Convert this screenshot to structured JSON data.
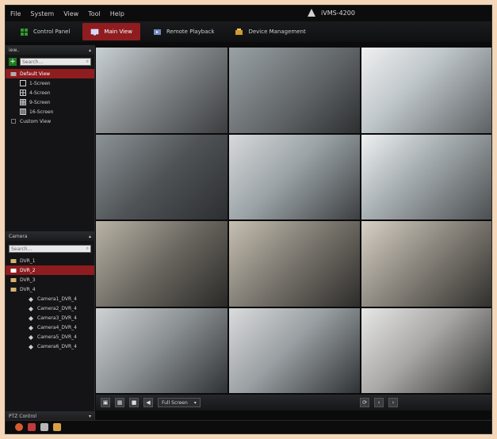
{
  "menubar": {
    "items": [
      "File",
      "System",
      "View",
      "Tool",
      "Help"
    ]
  },
  "app": {
    "title": "iVMS-4200"
  },
  "tabs": [
    {
      "label": "Control Panel",
      "icon": "grid-icon"
    },
    {
      "label": "Main View",
      "icon": "monitor-icon",
      "active": true
    },
    {
      "label": "Remote Playback",
      "icon": "playback-icon"
    },
    {
      "label": "Device Management",
      "icon": "device-icon"
    }
  ],
  "left": {
    "view_panel": {
      "title": "iew..",
      "search_placeholder": "Search..."
    },
    "view_tree": [
      {
        "label": "Default View",
        "selected": true
      },
      {
        "label": "1-Screen"
      },
      {
        "label": "4-Screen"
      },
      {
        "label": "9-Screen"
      },
      {
        "label": "16-Screen"
      },
      {
        "label": "Custom View"
      }
    ],
    "camera_panel": {
      "title": "Camera",
      "search_placeholder": "Search..."
    },
    "camera_tree": [
      {
        "label": "DVR_1"
      },
      {
        "label": "DVR_2",
        "selected": true
      },
      {
        "label": "DVR_3"
      },
      {
        "label": "DVR_4"
      },
      {
        "label": "Camera1_DVR_4"
      },
      {
        "label": "Camera2_DVR_4"
      },
      {
        "label": "Camera3_DVR_4"
      },
      {
        "label": "Camera4_DVR_4"
      },
      {
        "label": "Camera5_DVR_4"
      },
      {
        "label": "Camera6_DVR_4"
      }
    ],
    "ptz_title": "PTZ Control"
  },
  "grid": {
    "cells": [
      {
        "ts": "",
        "cam": ""
      },
      {
        "ts": "",
        "cam": ""
      },
      {
        "ts": "",
        "cam": ""
      },
      {
        "ts": "",
        "cam": ""
      },
      {
        "ts": "",
        "cam": ""
      },
      {
        "ts": "",
        "cam": ""
      },
      {
        "ts": "",
        "cam": ""
      },
      {
        "ts": "",
        "cam": ""
      },
      {
        "ts": "",
        "cam": ""
      },
      {
        "ts": "",
        "cam": ""
      },
      {
        "ts": "",
        "cam": ""
      },
      {
        "ts": "",
        "cam": ""
      }
    ]
  },
  "bottombar": {
    "full_screen_label": "Full Screen"
  },
  "colors": {
    "accent": "#8f1c1f",
    "bg": "#0b0b0c"
  }
}
